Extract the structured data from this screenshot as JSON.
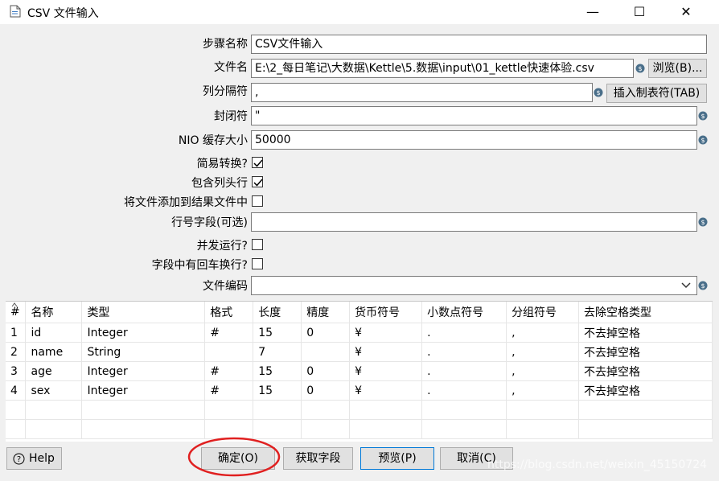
{
  "window": {
    "title": "CSV 文件输入",
    "minimize": "—",
    "maximize": "☐",
    "close": "✕"
  },
  "form": {
    "step_name": {
      "label": "步骤名称",
      "value": "CSV文件输入"
    },
    "filename": {
      "label": "文件名",
      "value": "E:\\2_每日笔记\\大数据\\Kettle\\5.数据\\input\\01_kettle快速体验.csv",
      "browse": "浏览(B)..."
    },
    "delimiter": {
      "label": "列分隔符",
      "value": ",",
      "insert_tab": "插入制表符(TAB)"
    },
    "enclosure": {
      "label": "封闭符",
      "value": "\""
    },
    "nio_buffer": {
      "label": "NIO 缓存大小",
      "value": "50000"
    },
    "lazy_conversion": {
      "label": "简易转换?",
      "checked": true
    },
    "header_row": {
      "label": "包含列头行",
      "checked": true
    },
    "add_to_result": {
      "label": "将文件添加到结果文件中",
      "checked": false
    },
    "row_num_field": {
      "label": "行号字段(可选)",
      "value": ""
    },
    "parallel": {
      "label": "并发运行?",
      "checked": false
    },
    "newlines_in_fields": {
      "label": "字段中有回车换行?",
      "checked": false
    },
    "encoding": {
      "label": "文件编码",
      "value": ""
    }
  },
  "table": {
    "columns": [
      "#",
      "名称",
      "类型",
      "格式",
      "长度",
      "精度",
      "货币符号",
      "小数点符号",
      "分组符号",
      "去除空格类型"
    ],
    "rows": [
      [
        "1",
        "id",
        "Integer",
        "#",
        "15",
        "0",
        "¥",
        ".",
        ",",
        "不去掉空格"
      ],
      [
        "2",
        "name",
        "String",
        "",
        "7",
        "",
        "¥",
        ".",
        ",",
        "不去掉空格"
      ],
      [
        "3",
        "age",
        "Integer",
        "#",
        "15",
        "0",
        "¥",
        ".",
        ",",
        "不去掉空格"
      ],
      [
        "4",
        "sex",
        "Integer",
        "#",
        "15",
        "0",
        "¥",
        ".",
        ",",
        "不去掉空格"
      ]
    ]
  },
  "buttons": {
    "help": "Help",
    "ok": "确定(O)",
    "get_fields": "获取字段",
    "preview": "预览(P)",
    "cancel": "取消(C)"
  },
  "watermark": "https://blog.csdn.net/weixin_45150724",
  "colors": {
    "accent": "#0078d7",
    "annotation": "#e02020",
    "var_icon": "#4a6f8a"
  }
}
